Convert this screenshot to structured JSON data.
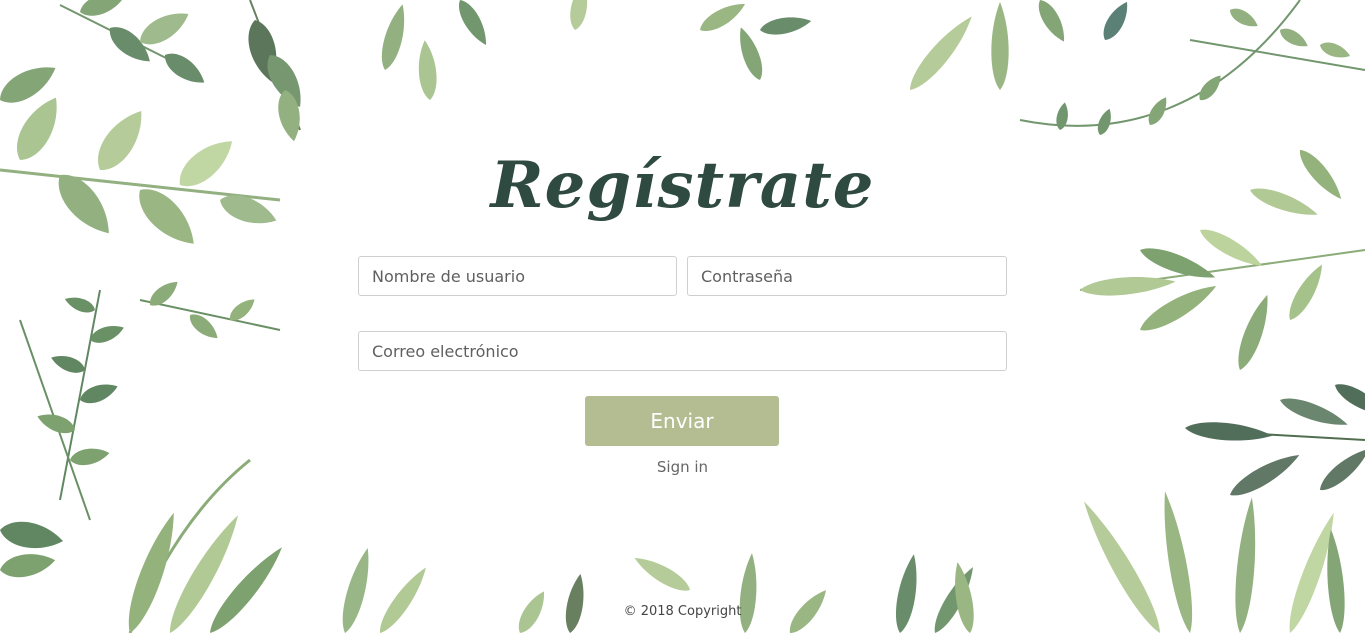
{
  "form": {
    "title": "Regístrate",
    "username_placeholder": "Nombre de usuario",
    "password_placeholder": "Contraseña",
    "email_placeholder": "Correo electrónico",
    "submit_label": "Enviar",
    "signin_link": "Sign in"
  },
  "footer": {
    "copyright": "© 2018 Copyright"
  },
  "colors": {
    "title": "#2f4a40",
    "button": "#b4bd92",
    "leaf_dark": "#4f7a52",
    "leaf_mid": "#7fa36a",
    "leaf_light": "#a9c489"
  },
  "background": {
    "decoration": "watercolor-leaves-frame"
  }
}
